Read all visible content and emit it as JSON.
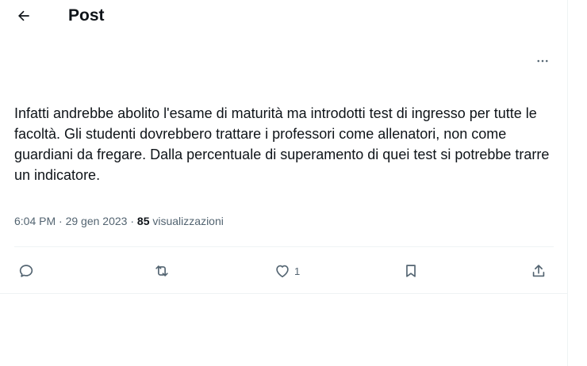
{
  "header": {
    "title": "Post",
    "back_icon": "arrow-left-icon"
  },
  "tweet": {
    "more_icon": "ellipsis-icon",
    "text": "Infatti andrebbe abolito l'esame di maturità ma introdotti test di ingresso per tutte le facoltà. Gli studenti dovrebbero trattare i professori come allenatori, non come guardiani da fregare. Dalla percentuale di superamento di quei test si potrebbe trarre un indicatore.",
    "time": "6:04 PM",
    "separator": "·",
    "date": "29 gen 2023",
    "views_count": "85",
    "views_label": "visualizzazioni"
  },
  "actions": {
    "reply_icon": "reply-icon",
    "repost_icon": "repost-icon",
    "like_icon": "heart-icon",
    "like_count": "1",
    "bookmark_icon": "bookmark-icon",
    "share_icon": "share-icon"
  },
  "colors": {
    "text_primary": "#0f1419",
    "text_secondary": "#536471",
    "divider": "#eff3f4"
  }
}
